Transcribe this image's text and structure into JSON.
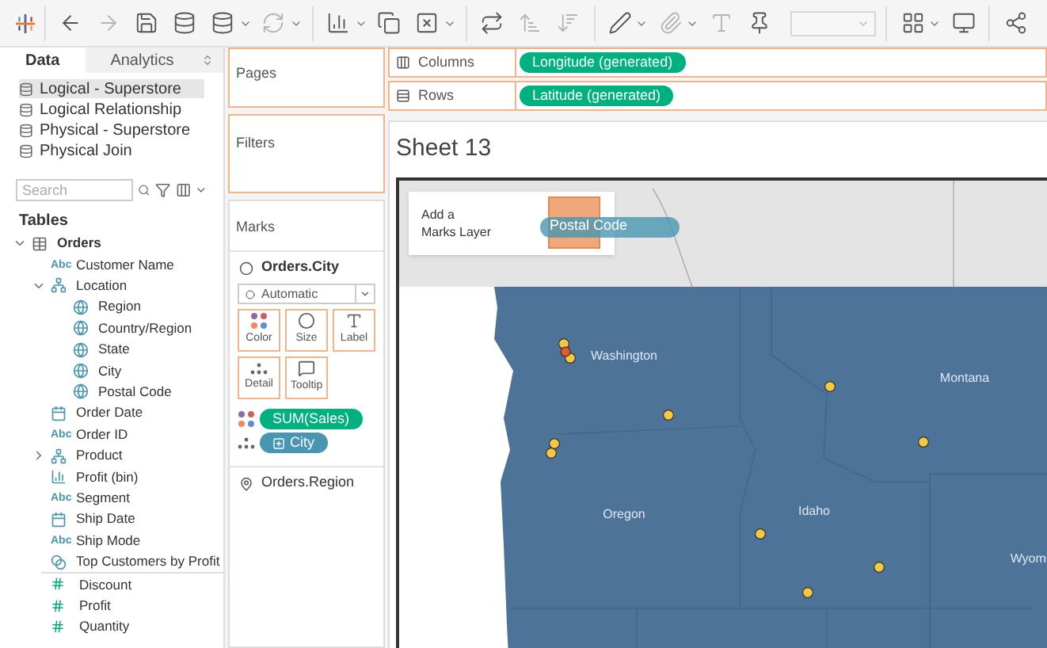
{
  "data_pane": {
    "tabs": [
      {
        "label": "Data",
        "selected": true
      },
      {
        "label": "Analytics",
        "selected": false
      }
    ],
    "data_sources": [
      {
        "name": "Logical - Superstore",
        "selected": true
      },
      {
        "name": "Logical Relationship",
        "selected": false
      },
      {
        "name": "Physical - Superstore",
        "selected": false
      },
      {
        "name": "Physical Join",
        "selected": false
      }
    ],
    "search": {
      "placeholder": "Search"
    },
    "tables_heading": "Tables",
    "tree": [
      {
        "label": "Orders",
        "kind": "table",
        "expanded": true,
        "children": [
          {
            "label": "Customer Name",
            "kind": "string",
            "badge": "Abc"
          },
          {
            "label": "Location",
            "kind": "hierarchy",
            "expanded": true,
            "children": [
              {
                "label": "Region",
                "kind": "geo"
              },
              {
                "label": "Country/Region",
                "kind": "geo"
              },
              {
                "label": "State",
                "kind": "geo"
              },
              {
                "label": "City",
                "kind": "geo"
              },
              {
                "label": "Postal Code",
                "kind": "geo"
              }
            ]
          },
          {
            "label": "Order Date",
            "kind": "date"
          },
          {
            "label": "Order ID",
            "kind": "string",
            "badge": "Abc"
          },
          {
            "label": "Product",
            "kind": "hierarchy",
            "expanded": false
          },
          {
            "label": "Profit (bin)",
            "kind": "bin"
          },
          {
            "label": "Segment",
            "kind": "string",
            "badge": "Abc"
          },
          {
            "label": "Ship Date",
            "kind": "date"
          },
          {
            "label": "Ship Mode",
            "kind": "string",
            "badge": "Abc"
          },
          {
            "label": "Top Customers by Profit",
            "kind": "set"
          }
        ]
      }
    ],
    "measures": [
      {
        "label": "Discount"
      },
      {
        "label": "Profit"
      },
      {
        "label": "Quantity"
      }
    ]
  },
  "cards": {
    "pages": "Pages",
    "filters": "Filters"
  },
  "shelves": [
    {
      "label": "Columns",
      "kind": "columns",
      "pills": [
        {
          "text": "Longitude (generated)",
          "color": "#00b180"
        }
      ]
    },
    {
      "label": "Rows",
      "kind": "rows",
      "pills": [
        {
          "text": "Latitude (generated)",
          "color": "#00b180"
        }
      ]
    }
  ],
  "marks": {
    "title": "Marks",
    "layers": [
      {
        "name": "Orders.City",
        "kind": "points",
        "expanded": true,
        "mark_type": "Automatic",
        "buttons": [
          {
            "label": "Color",
            "kind": "color"
          },
          {
            "label": "Size",
            "kind": "size"
          },
          {
            "label": "Label",
            "kind": "label"
          },
          {
            "label": "Detail",
            "kind": "detail"
          },
          {
            "label": "Tooltip",
            "kind": "tooltip"
          }
        ],
        "pills": [
          {
            "text": "SUM(Sales)",
            "kind": "color",
            "color": "#00b180"
          },
          {
            "text": "City",
            "kind": "detail",
            "color": "#4996b2"
          }
        ]
      },
      {
        "name": "Orders.Region",
        "kind": "polygons",
        "expanded": false
      }
    ]
  },
  "sheet": {
    "title": "Sheet 13",
    "drop_target": {
      "text": "Add a Marks Layer",
      "dragged_pill": "Postal Code"
    },
    "map_labels": [
      "Washington",
      "Montana",
      "Oregon",
      "Idaho",
      "Wyomi"
    ]
  }
}
